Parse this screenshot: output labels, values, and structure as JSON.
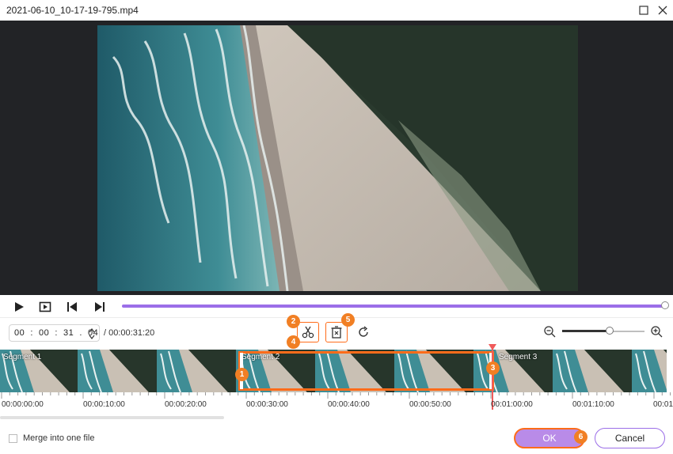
{
  "window": {
    "title": "2021-06-10_10-17-19-795.mp4"
  },
  "player": {
    "progress": 1.0
  },
  "editor": {
    "current_time": "00  :  00  :  31  .  04",
    "total_time": "/ 00:00:31:20",
    "zoom_level": 0.58
  },
  "segments": [
    {
      "label": "Segment 1"
    },
    {
      "label": "Segment 2"
    },
    {
      "label": "Segment 3"
    }
  ],
  "badges": [
    "1",
    "2",
    "3",
    "4",
    "5",
    "6"
  ],
  "ruler": {
    "ticks": [
      "00:00:00:00",
      "00:00:10:00",
      "00:00:20:00",
      "00:00:30:00",
      "00:00:40:00",
      "00:00:50:00",
      "00:01:00:00",
      "00:01:10:00",
      "00:01"
    ]
  },
  "footer": {
    "merge_label": "Merge into one file",
    "ok_label": "OK",
    "cancel_label": "Cancel"
  },
  "colors": {
    "accent": "#9b6ee8",
    "highlight": "#ff6c1a",
    "badge": "#f17f24",
    "playhead": "#f05a5a"
  }
}
